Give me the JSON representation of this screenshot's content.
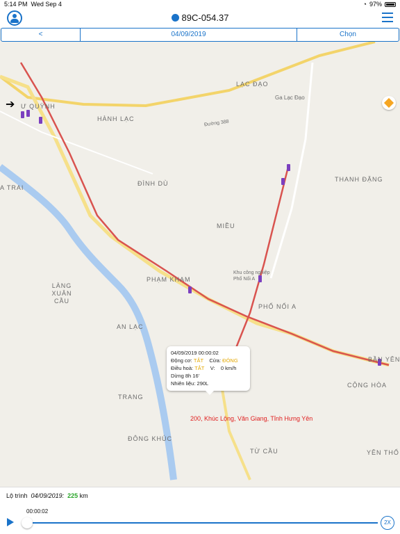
{
  "status": {
    "time": "5:14 PM",
    "date": "Wed Sep 4",
    "battery": "97%"
  },
  "nav": {
    "title": "89C-054.37"
  },
  "segments": {
    "prev": "<",
    "date": "04/09/2019",
    "choose": "Chọn"
  },
  "map_labels": [
    "HÀNH LẠC",
    "ĐÌNH DÙ",
    "MIỀU",
    "PHẠM KHAM",
    "AN LẠC",
    "TRANG",
    "ĐÔNG KHÚC",
    "TỪ CẦU",
    "YÊN THỔ",
    "CỘNG HÒA",
    "BẦN YÊN N",
    "PHỐ NỐI A",
    "THANH ĐẶNG",
    "LÀNG XUÂN CẦU",
    "A TRAI",
    "Ư QUỲNH",
    "Ga Lạc Đạo",
    "Đường 388",
    "Khu công nghiệp Phố Nối A",
    "LẠC ĐẠO"
  ],
  "popup": {
    "time": "04/09/2019 00:00:02",
    "engine_label": "Động cơ:",
    "engine_value": "TẮT",
    "door_label": "Cửa:",
    "door_value": "ĐÓNG",
    "ac_label": "Điều hoà:",
    "ac_value": "TẮT",
    "v_label": "V:",
    "v_value": "0 km/h",
    "stop": "Dừng 8h 16'",
    "fuel": "Nhiên liệu: 290L"
  },
  "address": "200, Khúc Lộng, Văn Giang, Tỉnh Hưng Yên",
  "footer": {
    "route_label": "Lộ trình",
    "route_date": "04/09/2019:",
    "distance": "225",
    "unit": "km",
    "playback_time": "00:00:02",
    "speed": "2X"
  },
  "colors": {
    "accent": "#1a73c9",
    "route": "#d9534f",
    "distance": "#2aa52a"
  }
}
